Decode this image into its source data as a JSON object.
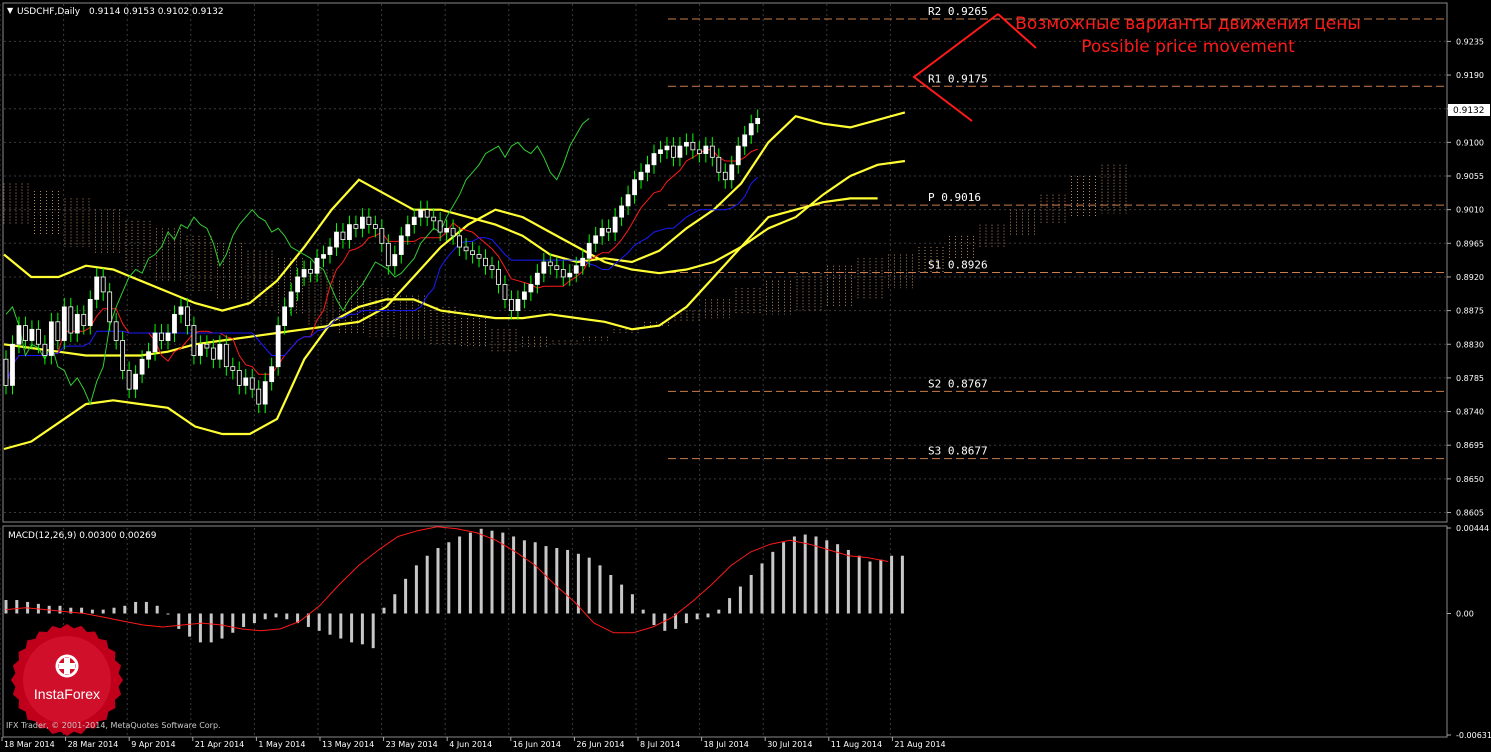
{
  "chart_data": [
    {
      "type": "candlestick",
      "title": "USDCHF,Daily",
      "ohlc_header": "0.9114 0.9153 0.9102 0.9132",
      "current_price": "0.9132",
      "annotation_ru": "Возможные варианты движения цены",
      "annotation_en": "Possible price movement",
      "ylim": [
        0.8595,
        0.9285
      ],
      "y_ticks": [
        "0.9235",
        "0.9190",
        "0.9145",
        "0.9100",
        "0.9055",
        "0.9010",
        "0.8965",
        "0.8920",
        "0.8875",
        "0.8830",
        "0.8785",
        "0.8740",
        "0.8695",
        "0.8650",
        "0.8605"
      ],
      "x_labels": [
        "18 Mar 2014",
        "28 Mar 2014",
        "9 Apr 2014",
        "21 Apr 2014",
        "1 May 2014",
        "13 May 2014",
        "23 May 2014",
        "4 Jun 2014",
        "16 Jun 2014",
        "26 Jun 2014",
        "8 Jul 2014",
        "18 Jul 2014",
        "30 Jul 2014",
        "11 Aug 2014",
        "21 Aug 2014"
      ],
      "pivot_levels": [
        {
          "label": "R2",
          "value": 0.9265,
          "text": "0.9265"
        },
        {
          "label": "R1",
          "value": 0.9175,
          "text": "0.9175"
        },
        {
          "label": "P",
          "value": 0.9016,
          "text": "0.9016"
        },
        {
          "label": "S1",
          "value": 0.8926,
          "text": "0.8926"
        },
        {
          "label": "S2",
          "value": 0.8767,
          "text": "0.8767"
        },
        {
          "label": "S3",
          "value": 0.8677,
          "text": "0.8677"
        }
      ],
      "closes": [
        0.8775,
        0.883,
        0.8855,
        0.8835,
        0.885,
        0.883,
        0.8815,
        0.886,
        0.8835,
        0.888,
        0.8845,
        0.887,
        0.8855,
        0.889,
        0.892,
        0.89,
        0.886,
        0.8835,
        0.8795,
        0.877,
        0.879,
        0.881,
        0.882,
        0.8845,
        0.8835,
        0.8845,
        0.887,
        0.888,
        0.8855,
        0.8815,
        0.883,
        0.8825,
        0.881,
        0.883,
        0.88,
        0.8795,
        0.8775,
        0.8785,
        0.877,
        0.875,
        0.878,
        0.88,
        0.8855,
        0.888,
        0.89,
        0.892,
        0.893,
        0.8925,
        0.8945,
        0.895,
        0.896,
        0.898,
        0.897,
        0.899,
        0.8985,
        0.9,
        0.899,
        0.8985,
        0.8965,
        0.8935,
        0.895,
        0.8975,
        0.899,
        0.9,
        0.901,
        0.9,
        0.8995,
        0.898,
        0.8985,
        0.8975,
        0.896,
        0.8955,
        0.895,
        0.8945,
        0.8935,
        0.893,
        0.891,
        0.889,
        0.8875,
        0.889,
        0.89,
        0.891,
        0.8925,
        0.894,
        0.8935,
        0.893,
        0.892,
        0.8925,
        0.8935,
        0.8945,
        0.8965,
        0.8975,
        0.8985,
        0.898,
        0.9,
        0.9015,
        0.903,
        0.905,
        0.906,
        0.907,
        0.9085,
        0.909,
        0.9095,
        0.908,
        0.9095,
        0.91,
        0.909,
        0.9085,
        0.9095,
        0.908,
        0.906,
        0.905,
        0.907,
        0.9095,
        0.911,
        0.9125,
        0.9132
      ],
      "bollinger_middle": [
        0.883,
        0.8825,
        0.882,
        0.8815,
        0.8815,
        0.8815,
        0.882,
        0.883,
        0.8835,
        0.884,
        0.8845,
        0.885,
        0.8855,
        0.886,
        0.888,
        0.892,
        0.896,
        0.899,
        0.901,
        0.9,
        0.898,
        0.896,
        0.894,
        0.893,
        0.8925,
        0.893,
        0.894,
        0.896,
        0.8985,
        0.9,
        0.903,
        0.9055,
        0.907,
        0.9075
      ],
      "bollinger_upper": [
        0.895,
        0.892,
        0.892,
        0.8935,
        0.893,
        0.8915,
        0.89,
        0.8885,
        0.8875,
        0.8885,
        0.8915,
        0.896,
        0.901,
        0.905,
        0.903,
        0.901,
        0.901,
        0.9,
        0.899,
        0.8975,
        0.895,
        0.894,
        0.8945,
        0.894,
        0.8955,
        0.8985,
        0.901,
        0.9045,
        0.91,
        0.9135,
        0.9125,
        0.912,
        0.913,
        0.914
      ],
      "bollinger_lower": [
        0.869,
        0.87,
        0.8725,
        0.875,
        0.8755,
        0.875,
        0.8745,
        0.872,
        0.871,
        0.871,
        0.873,
        0.881,
        0.886,
        0.888,
        0.889,
        0.889,
        0.8875,
        0.887,
        0.8865,
        0.8865,
        0.887,
        0.8865,
        0.886,
        0.885,
        0.8855,
        0.888,
        0.892,
        0.896,
        0.9,
        0.901,
        0.902,
        0.9025,
        0.9025
      ],
      "series_colors": {
        "bull": "#ffffff",
        "bear": "#ffffff",
        "wick": "#00ff00",
        "bollinger": "#ffff33",
        "tenkan": "#ff1a1a",
        "kijun": "#1a1aff",
        "chikou": "#33cc33",
        "kumo": "#d2a06e",
        "pivot": "#c97b4e",
        "annotation": "#ff1a1a"
      }
    },
    {
      "type": "bar",
      "title": "MACD(12,26,9) 0.00300 0.00269",
      "ylim": [
        -0.00631,
        0.00444
      ],
      "y_ticks": [
        "0.00444",
        "0.00",
        "-0.00631"
      ],
      "histogram": [
        0.0007,
        0.0007,
        0.0006,
        0.0005,
        0.0004,
        0.0004,
        0.0003,
        0.0003,
        0.0002,
        0.0002,
        0.0003,
        0.0004,
        0.0006,
        0.0006,
        0.0004,
        0.0,
        -0.0008,
        -0.0012,
        -0.0015,
        -0.0015,
        -0.0013,
        -0.001,
        -0.0007,
        -0.0005,
        -0.0003,
        -0.0002,
        -0.0003,
        -0.0005,
        -0.0007,
        -0.0009,
        -0.0011,
        -0.0013,
        -0.0015,
        -0.0016,
        -0.0018,
        0.0003,
        0.001,
        0.0018,
        0.0025,
        0.003,
        0.0034,
        0.0037,
        0.004,
        0.0042,
        0.0044,
        0.0043,
        0.0042,
        0.004,
        0.0038,
        0.0037,
        0.0035,
        0.0034,
        0.0033,
        0.0031,
        0.0029,
        0.0025,
        0.002,
        0.0015,
        0.001,
        0.0002,
        -0.0006,
        -0.0009,
        -0.0008,
        -0.0005,
        -0.0003,
        -0.0002,
        0.0002,
        0.0008,
        0.0014,
        0.002,
        0.0026,
        0.0032,
        0.0037,
        0.004,
        0.0041,
        0.004,
        0.0038,
        0.0036,
        0.0033,
        0.003,
        0.0027,
        0.0028,
        0.003,
        0.003
      ],
      "signal": [
        0.0002,
        0.0003,
        0.0002,
        0.0001,
        0.0,
        -0.0002,
        -0.0004,
        -0.0006,
        -0.0007,
        -0.0006,
        -0.0005,
        -0.0006,
        -0.0008,
        -0.0009,
        -0.0008,
        -0.0004,
        0.0004,
        0.0015,
        0.0025,
        0.0033,
        0.004,
        0.0043,
        0.0045,
        0.0044,
        0.0042,
        0.0038,
        0.0032,
        0.0025,
        0.0015,
        0.0006,
        -0.0005,
        -0.001,
        -0.001,
        -0.0007,
        -0.0002,
        0.0006,
        0.0015,
        0.0025,
        0.0032,
        0.0036,
        0.0038,
        0.0036,
        0.0033,
        0.003,
        0.0029,
        0.0027
      ],
      "colors": {
        "histogram": "#c8c8c8",
        "signal": "#ff1a1a"
      }
    }
  ],
  "footer": {
    "copyright": "IFX Trader, © 2001-2014, MetaQuotes Software Corp."
  },
  "logo": {
    "text": "InstaForex"
  }
}
